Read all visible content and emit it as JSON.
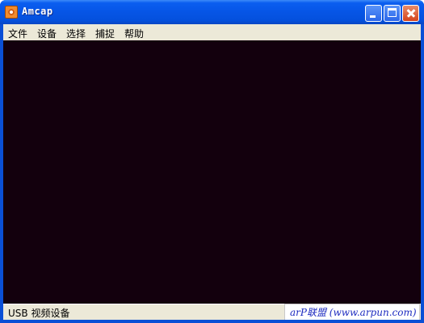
{
  "window": {
    "title": "Amcap"
  },
  "menu": {
    "items": [
      "文件",
      "设备",
      "选择",
      "捕捉",
      "帮助"
    ]
  },
  "status": {
    "device": "USB 视频设备"
  },
  "watermark": {
    "text": "arP联盟 (www.arpun.com)"
  },
  "icons": [
    "app-icon",
    "minimize-icon",
    "maximize-icon",
    "close-icon"
  ],
  "colors": {
    "titlebar": "#0655e6",
    "preview": "#13000d",
    "menubar": "#ece9d8",
    "watermark_text": "#1d2bc0"
  }
}
